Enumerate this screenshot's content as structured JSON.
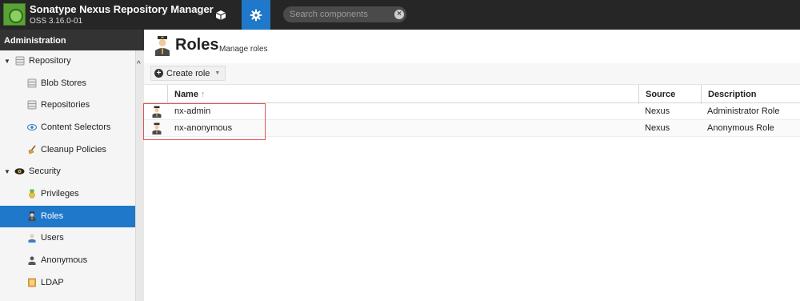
{
  "app": {
    "title": "Sonatype Nexus Repository Manager",
    "version": "OSS 3.16.0-01"
  },
  "nav": {
    "browse_icon": "cube-icon",
    "admin_icon": "gear-icon",
    "active": "admin"
  },
  "search": {
    "placeholder": "Search components",
    "value": "",
    "clear_symbol": "×"
  },
  "sidebar": {
    "header": "Administration",
    "groups": [
      {
        "label": "Repository",
        "icon": "database-icon",
        "expanded": true,
        "items": [
          {
            "label": "Blob Stores",
            "icon": "database-icon"
          },
          {
            "label": "Repositories",
            "icon": "database-icon"
          },
          {
            "label": "Content Selectors",
            "icon": "eye-icon"
          },
          {
            "label": "Cleanup Policies",
            "icon": "broom-icon"
          }
        ]
      },
      {
        "label": "Security",
        "icon": "security-eye-icon",
        "expanded": true,
        "items": [
          {
            "label": "Privileges",
            "icon": "medal-icon"
          },
          {
            "label": "Roles",
            "icon": "officer-icon",
            "selected": true
          },
          {
            "label": "Users",
            "icon": "users-icon"
          },
          {
            "label": "Anonymous",
            "icon": "user-silhouette-icon"
          },
          {
            "label": "LDAP",
            "icon": "book-icon"
          }
        ]
      }
    ]
  },
  "main": {
    "title": "Roles",
    "subtitle": "Manage roles",
    "create_button": "Create role",
    "columns": {
      "name": "Name",
      "name_sort": "↑",
      "source": "Source",
      "description": "Description"
    },
    "rows": [
      {
        "name": "nx-admin",
        "source": "Nexus",
        "description": "Administrator Role"
      },
      {
        "name": "nx-anonymous",
        "source": "Nexus",
        "description": "Anonymous Role"
      }
    ]
  },
  "colors": {
    "topbar": "#262626",
    "accent": "#1f78c9",
    "highlight": "#e05555"
  }
}
